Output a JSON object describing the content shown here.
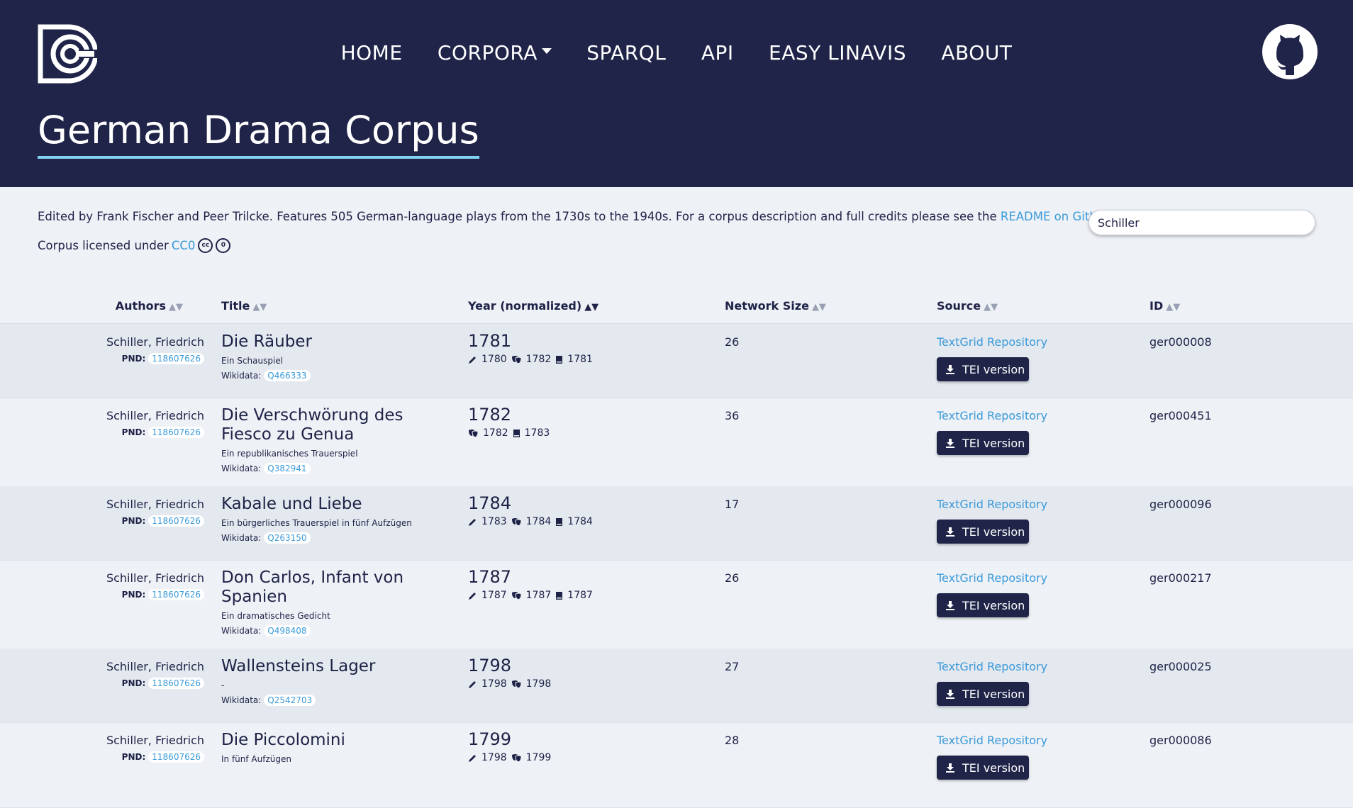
{
  "header": {
    "nav": [
      "HOME",
      "CORPORA",
      "SPARQL",
      "API",
      "EASY LINAVIS",
      "ABOUT"
    ],
    "title": "German Drama Corpus"
  },
  "intro": {
    "text_before": "Edited by Frank Fischer and Peer Trilcke. Features 505 German-language plays from the 1730s to the 1940s. For a corpus description and full credits please see the ",
    "link": "README on GitHub",
    "text_after": ".",
    "license_prefix": "Corpus licensed under ",
    "license_link": "CC0"
  },
  "search": {
    "value": "Schiller"
  },
  "columns": [
    "Authors",
    "Title",
    "Year (normalized)",
    "Network Size",
    "Source",
    "ID"
  ],
  "rows": [
    {
      "author": "Schiller, Friedrich",
      "pnd_label": "PND:",
      "pnd": "118607626",
      "title": "Die Räuber",
      "subtitle": "Ein Schauspiel",
      "wd_label": "Wikidata:",
      "wikidata": "Q466333",
      "year": "1781",
      "written": "1780",
      "premiere": "1782",
      "print": "1781",
      "network": "26",
      "source": "TextGrid Repository",
      "tei": "TEI version",
      "id": "ger000008"
    },
    {
      "author": "Schiller, Friedrich",
      "pnd_label": "PND:",
      "pnd": "118607626",
      "title": "Die Verschwörung des Fiesco zu Genua",
      "subtitle": "Ein republikanisches Trauerspiel",
      "wd_label": "Wikidata:",
      "wikidata": "Q382941",
      "year": "1782",
      "written": "",
      "premiere": "1782",
      "print": "1783",
      "network": "36",
      "source": "TextGrid Repository",
      "tei": "TEI version",
      "id": "ger000451"
    },
    {
      "author": "Schiller, Friedrich",
      "pnd_label": "PND:",
      "pnd": "118607626",
      "title": "Kabale und Liebe",
      "subtitle": "Ein bürgerliches Trauerspiel in fünf Aufzügen",
      "wd_label": "Wikidata:",
      "wikidata": "Q263150",
      "year": "1784",
      "written": "1783",
      "premiere": "1784",
      "print": "1784",
      "network": "17",
      "source": "TextGrid Repository",
      "tei": "TEI version",
      "id": "ger000096"
    },
    {
      "author": "Schiller, Friedrich",
      "pnd_label": "PND:",
      "pnd": "118607626",
      "title": "Don Carlos, Infant von Spanien",
      "subtitle": "Ein dramatisches Gedicht",
      "wd_label": "Wikidata:",
      "wikidata": "Q498408",
      "year": "1787",
      "written": "1787",
      "premiere": "1787",
      "print": "1787",
      "network": "26",
      "source": "TextGrid Repository",
      "tei": "TEI version",
      "id": "ger000217"
    },
    {
      "author": "Schiller, Friedrich",
      "pnd_label": "PND:",
      "pnd": "118607626",
      "title": "Wallensteins Lager",
      "subtitle": "-",
      "wd_label": "Wikidata:",
      "wikidata": "Q2542703",
      "year": "1798",
      "written": "1798",
      "premiere": "1798",
      "print": "",
      "network": "27",
      "source": "TextGrid Repository",
      "tei": "TEI version",
      "id": "ger000025"
    },
    {
      "author": "Schiller, Friedrich",
      "pnd_label": "PND:",
      "pnd": "118607626",
      "title": "Die Piccolomini",
      "subtitle": "In fünf Aufzügen",
      "wd_label": "Wikidata:",
      "wikidata": "",
      "year": "1799",
      "written": "1798",
      "premiere": "1799",
      "print": "",
      "network": "28",
      "source": "TextGrid Repository",
      "tei": "TEI version",
      "id": "ger000086"
    }
  ]
}
